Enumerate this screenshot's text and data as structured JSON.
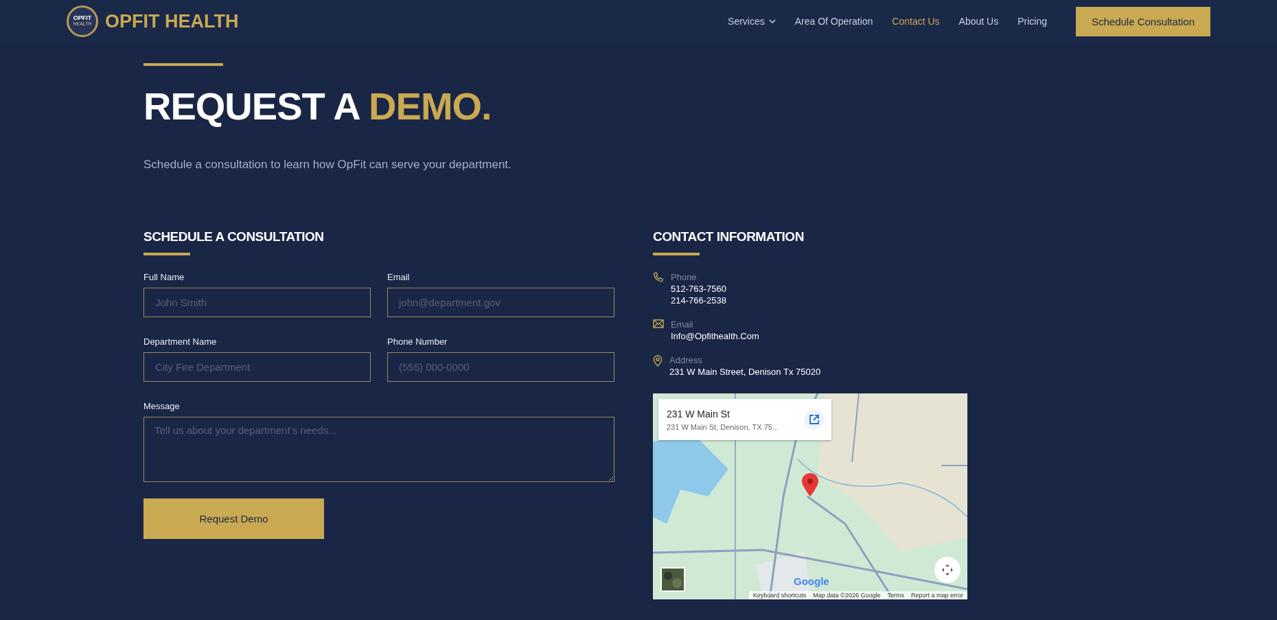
{
  "header": {
    "logo": {
      "badge_text": "OPFIT",
      "badge_subtext": "HEALTH",
      "name": "OPFIT HEALTH"
    },
    "nav": [
      {
        "label": "Services",
        "selected": false,
        "has_dropdown": true
      },
      {
        "label": "Area Of Operation",
        "selected": false,
        "has_dropdown": false
      },
      {
        "label": "Contact Us",
        "selected": true,
        "has_dropdown": false
      },
      {
        "label": "About Us",
        "selected": false,
        "has_dropdown": false
      },
      {
        "label": "Pricing",
        "selected": false,
        "has_dropdown": false
      }
    ],
    "cta": "Schedule Consultation"
  },
  "hero": {
    "title": "REQUEST A",
    "title_highlight": "DEMO.",
    "subtitle": "Schedule a consultation to learn how OpFit can serve your department."
  },
  "form": {
    "heading": "SCHEDULE A CONSULTATION",
    "fields": [
      {
        "kind": "input",
        "label": "Full Name",
        "placeholder": "John Smith"
      },
      {
        "kind": "input",
        "label": "Email",
        "placeholder": "john@department.gov"
      },
      {
        "kind": "input",
        "label": "Department Name",
        "placeholder": "City Fire Department"
      },
      {
        "kind": "input",
        "label": "Phone Number",
        "placeholder": "(555) 000-0000"
      },
      {
        "kind": "textarea",
        "label": "Message",
        "placeholder": "Tell us about your department’s needs..."
      }
    ],
    "submit": "Request Demo"
  },
  "contact": {
    "heading": "CONTACT INFORMATION",
    "items": [
      {
        "kind": "phone",
        "label": "Phone",
        "values": [
          "512-763-7560",
          "214-766-2538"
        ]
      },
      {
        "kind": "email",
        "label": "Email",
        "values": [
          "Info@Opfithealth.Com"
        ]
      },
      {
        "kind": "address",
        "label": "Address",
        "values": [
          "231 W Main Street, Denison Tx 75020"
        ]
      }
    ],
    "map": {
      "card_title": "231 W Main St",
      "card_subtitle": "231 W Main St, Denison, TX 75...",
      "logo": "Google",
      "footer": [
        "Keyboard shortcuts",
        "Map data ©2026 Google",
        "Terms",
        "Report a map error"
      ]
    }
  }
}
